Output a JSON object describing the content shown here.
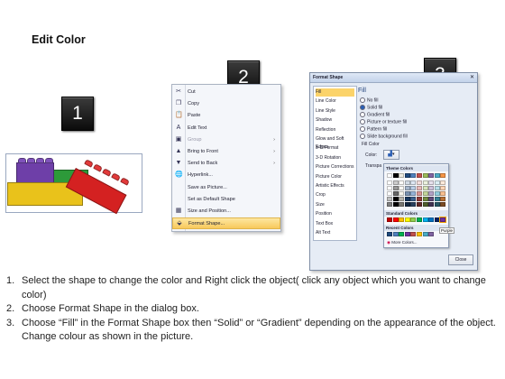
{
  "title": "Edit Color",
  "badges": [
    "1",
    "2",
    "3"
  ],
  "context_menu": {
    "items": [
      {
        "icon": "cut-icon",
        "glyph": "✂",
        "label": "Cut",
        "disabled": false,
        "arrow": false
      },
      {
        "icon": "copy-icon",
        "glyph": "❐",
        "label": "Copy",
        "disabled": false,
        "arrow": false
      },
      {
        "icon": "paste-icon",
        "glyph": "📋",
        "label": "Paste",
        "disabled": false,
        "arrow": false
      },
      {
        "icon": "edit-text-icon",
        "glyph": "A",
        "label": "Edit Text",
        "disabled": false,
        "arrow": false
      },
      {
        "icon": "group-icon",
        "glyph": "▣",
        "label": "Group",
        "disabled": true,
        "arrow": true
      },
      {
        "icon": "bring-front-icon",
        "glyph": "▲",
        "label": "Bring to Front",
        "disabled": false,
        "arrow": true
      },
      {
        "icon": "send-back-icon",
        "glyph": "▼",
        "label": "Send to Back",
        "disabled": false,
        "arrow": true
      },
      {
        "icon": "hyperlink-icon",
        "glyph": "🌐",
        "label": "Hyperlink...",
        "disabled": false,
        "arrow": false
      },
      {
        "icon": "",
        "glyph": "",
        "label": "Save as Picture...",
        "disabled": false,
        "arrow": false
      },
      {
        "icon": "",
        "glyph": "",
        "label": "Set as Default Shape",
        "disabled": false,
        "arrow": false
      },
      {
        "icon": "size-position-icon",
        "glyph": "▦",
        "label": "Size and Position...",
        "disabled": false,
        "arrow": false
      },
      {
        "icon": "format-shape-icon",
        "glyph": "⬙",
        "label": "Format Shape...",
        "disabled": false,
        "arrow": false,
        "highlighted": true
      }
    ]
  },
  "dialog": {
    "title": "Format Shape",
    "nav": [
      "Fill",
      "Line Color",
      "Line Style",
      "Shadow",
      "Reflection",
      "Glow and Soft Edges",
      "3-D Format",
      "3-D Rotation",
      "Picture Corrections",
      "Picture Color",
      "Artistic Effects",
      "Crop",
      "Size",
      "Position",
      "Text Box",
      "Alt Text"
    ],
    "selected_nav": "Fill",
    "pane_title": "Fill",
    "options": [
      "No fill",
      "Solid fill",
      "Gradient fill",
      "Picture or texture fill",
      "Pattern fill",
      "Slide background fill"
    ],
    "selected_option": "Solid fill",
    "fill_color_label": "Fill Color",
    "color_label": "Color:",
    "transparency_label": "Transpa",
    "close_label": "Close"
  },
  "color_picker": {
    "theme_label": "Theme Colors",
    "standard_label": "Standard Colors",
    "recent_label": "Recent Colors",
    "more_label": "More Colors...",
    "tooltip": "Purple",
    "theme_top": [
      "#ffffff",
      "#000000",
      "#eeece1",
      "#1f497d",
      "#4f81bd",
      "#c0504d",
      "#9bbb59",
      "#8064a2",
      "#4bacc6",
      "#f79646"
    ],
    "standard": [
      "#c00000",
      "#ff0000",
      "#ffc000",
      "#ffff00",
      "#92d050",
      "#00b050",
      "#00b0f0",
      "#0070c0",
      "#002060",
      "#7030a0"
    ],
    "recent": [
      "#1f497d",
      "#4f81bd",
      "#00b050",
      "#7030a0",
      "#c0504d",
      "#ffc000",
      "#4bacc6",
      "#8064a2"
    ]
  },
  "instructions": [
    {
      "num": "1.",
      "text": "Select the shape to change the color and Right click the object( click any object which you want to change color)"
    },
    {
      "num": "2.",
      "text": "Choose Format Shape in the dialog box."
    },
    {
      "num": "3.",
      "text": "Choose “Fill” in the Format Shape box then “Solid” or “Gradient” depending on the appearance of the object. Change colour as shown in the picture."
    }
  ]
}
